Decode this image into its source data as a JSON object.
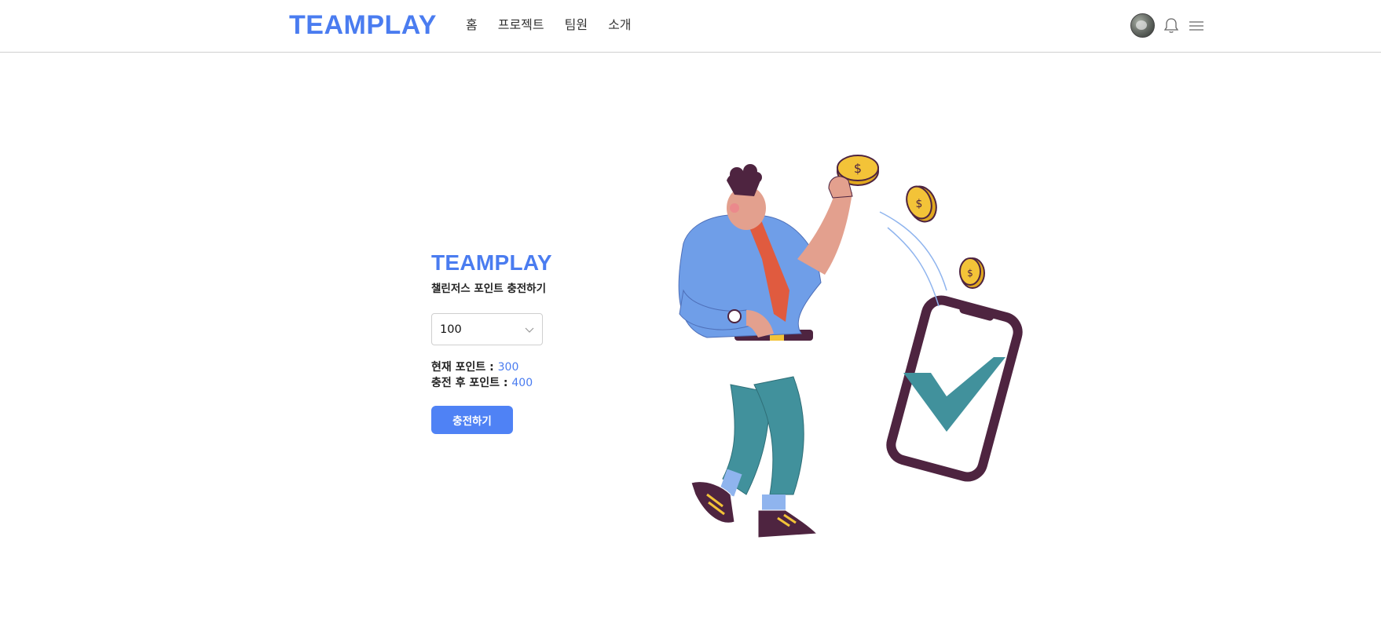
{
  "header": {
    "brand": "TEAMPLAY",
    "nav": [
      {
        "label": "홈"
      },
      {
        "label": "프로젝트"
      },
      {
        "label": "팀원"
      },
      {
        "label": "소개"
      }
    ],
    "icons": {
      "avatar": "avatar",
      "notification": "bell-icon",
      "menu": "hamburger-menu-icon"
    }
  },
  "panel": {
    "brand": "TEAMPLAY",
    "subtitle": "챌린저스 포인트 충전하기",
    "select": {
      "value": "100",
      "icon": "chevron-down-icon"
    },
    "current_points_label": "현재 포인트 : ",
    "current_points_value": "300",
    "after_points_label": "충전 후 포인트 : ",
    "after_points_value": "400",
    "charge_button": "충전하기"
  },
  "colors": {
    "brand": "#4a7cf0",
    "button": "#4f82f5"
  }
}
